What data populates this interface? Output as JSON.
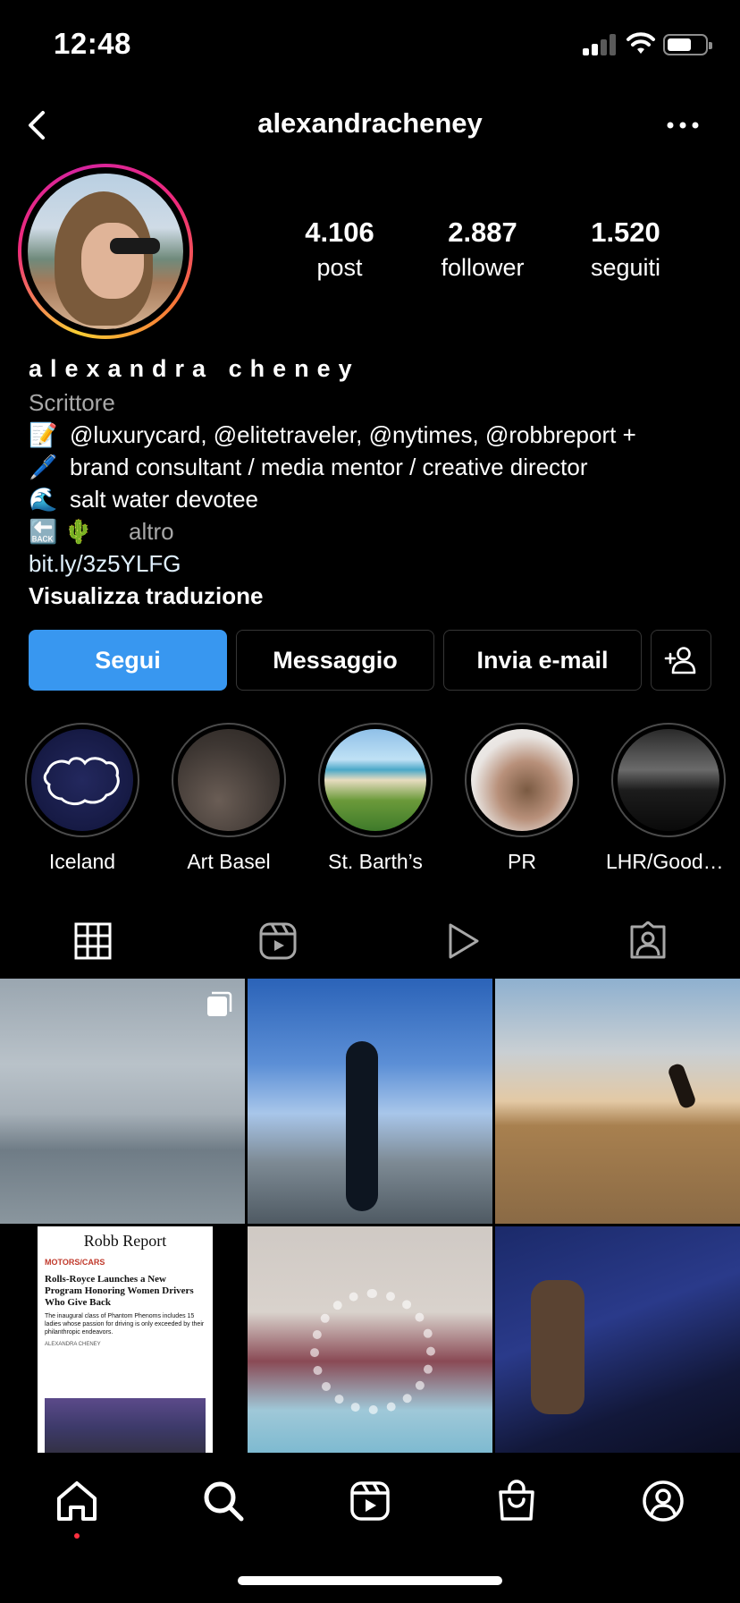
{
  "status_bar": {
    "time": "12:48"
  },
  "header": {
    "username": "alexandracheney"
  },
  "stats": [
    {
      "value": "4.106",
      "label": "post"
    },
    {
      "value": "2.887",
      "label": "follower"
    },
    {
      "value": "1.520",
      "label": "seguiti"
    }
  ],
  "bio": {
    "name": "alexandra cheney",
    "category": "Scrittore",
    "lines": [
      {
        "emoji": "📝",
        "text": "@luxurycard, @elitetraveler, @nytimes, @robbreport +"
      },
      {
        "emoji": "🖊️",
        "text": "brand consultant / media mentor / creative director"
      },
      {
        "emoji": "🌊",
        "text": "salt water devotee"
      },
      {
        "emoji": "🔙 🌵",
        "text": ""
      }
    ],
    "more_label": "altro",
    "url": "bit.ly/3z5YLFG",
    "translate_label": "Visualizza traduzione"
  },
  "actions": {
    "follow": "Segui",
    "message": "Messaggio",
    "email": "Invia e-mail"
  },
  "highlights": [
    {
      "label": "Iceland"
    },
    {
      "label": "Art Basel"
    },
    {
      "label": "St. Barth’s"
    },
    {
      "label": "PR"
    },
    {
      "label": "LHR/Goodw..."
    }
  ],
  "article": {
    "brand": "Robb Report",
    "section": "MOTORS/CARS",
    "headline": "Rolls-Royce Launches a New Program Honoring Women Drivers Who Give Back",
    "summary": "The inaugural class of Phantom Phenoms includes 15 ladies whose passion for driving is only exceeded by their philanthropic endeavors.",
    "author": "ALEXANDRA CHENEY"
  },
  "icons": {
    "back": "chevron-left-icon",
    "more": "ellipsis-icon",
    "add_user": "add-user-icon",
    "grid": "grid-icon",
    "reels": "reels-icon",
    "video": "play-icon",
    "tagged": "tagged-icon",
    "home": "home-icon",
    "search": "search-icon",
    "shop": "shop-icon",
    "profile": "profile-icon"
  },
  "colors": {
    "background": "#000000",
    "follow_button": "#3897f0",
    "notification_dot": "#ff3040"
  }
}
